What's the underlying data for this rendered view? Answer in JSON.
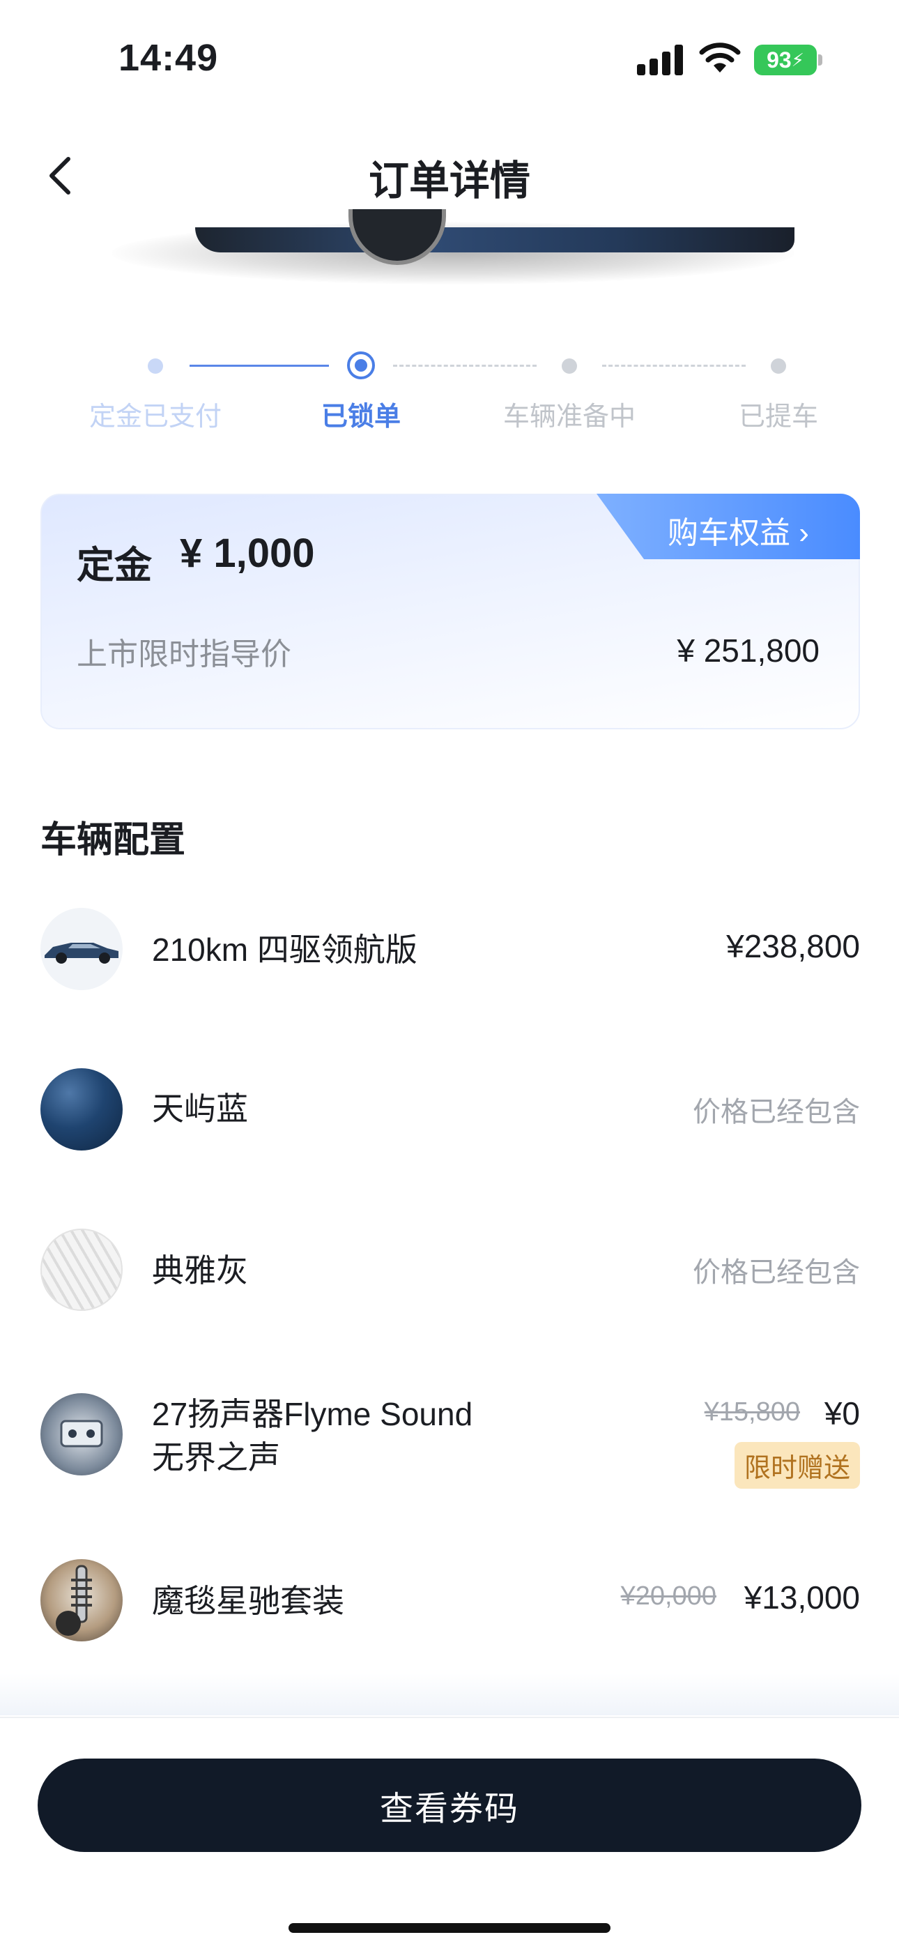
{
  "status_bar": {
    "time": "14:49",
    "battery": "93"
  },
  "nav": {
    "title": "订单详情"
  },
  "progress": {
    "steps": [
      {
        "label": "定金已支付",
        "state": "done"
      },
      {
        "label": "已锁单",
        "state": "current"
      },
      {
        "label": "车辆准备中",
        "state": "pending"
      },
      {
        "label": "已提车",
        "state": "pending"
      }
    ]
  },
  "deposit_card": {
    "tag": "购车权益 ›",
    "deposit_label": "定金",
    "deposit_amount": "¥ 1,000",
    "guide_label": "上市限时指导价",
    "guide_price": "¥ 251,800"
  },
  "config": {
    "title": "车辆配置",
    "items": [
      {
        "name": "210km 四驱领航版",
        "price": "¥238,800"
      },
      {
        "name": "天屿蓝",
        "note": "价格已经包含"
      },
      {
        "name": "典雅灰",
        "note": "价格已经包含"
      },
      {
        "name_line1": "27扬声器Flyme Sound",
        "name_line2": "无界之声",
        "original_price": "¥15,800",
        "price": "¥0",
        "badge": "限时赠送"
      },
      {
        "name": "魔毯星驰套装",
        "original_price": "¥20,000",
        "price": "¥13,000"
      }
    ]
  },
  "bottom": {
    "button": "查看券码"
  },
  "colors": {
    "accent": "#4a7ee6",
    "cta": "#111a28",
    "badge_bg": "#fbe6bc",
    "badge_text": "#b0721f"
  }
}
